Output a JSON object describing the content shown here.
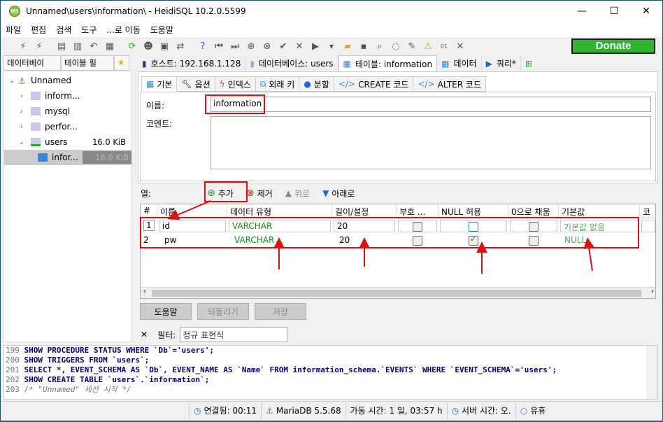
{
  "window": {
    "title": "Unnamed\\users\\information\\ - HeidiSQL 10.2.0.5599",
    "app_icon": "HS"
  },
  "menu": [
    "파일",
    "편집",
    "검색",
    "도구",
    "...로 이동",
    "도움말"
  ],
  "donate_label": "Donate",
  "left_tabs": [
    "데이터베이",
    "테이블 필"
  ],
  "tree": [
    {
      "label": "Unnamed",
      "size": ""
    },
    {
      "label": "inform...",
      "size": ""
    },
    {
      "label": "mysql",
      "size": ""
    },
    {
      "label": "perfor...",
      "size": ""
    },
    {
      "label": "users",
      "size": "16.0 KiB"
    },
    {
      "label": "infor...",
      "size": "16.0 KiB"
    }
  ],
  "main_tabs": [
    "호스트: 192.168.1.128",
    "데이터베이스: users",
    "테이블: information",
    "데이터",
    "쿼리*"
  ],
  "sub_tabs": [
    "기본",
    "옵션",
    "인덱스",
    "외래 키",
    "분할",
    "CREATE 코드",
    "ALTER 코드"
  ],
  "form": {
    "name_label": "이름:",
    "name_value": "information",
    "comment_label": "코멘트:"
  },
  "columns_bar": {
    "label": "열:",
    "add": "추가",
    "remove": "제거",
    "up": "위로",
    "down": "아래로"
  },
  "grid": {
    "headers": [
      "#",
      "이름",
      "데이터 유형",
      "길이/설정",
      "부호 ...",
      "NULL 허용",
      "0으로 채움",
      "기본값",
      "코"
    ],
    "rows": [
      {
        "num": "1",
        "name": "id",
        "type": "VARCHAR",
        "length": "20",
        "unsigned": false,
        "nullable": false,
        "zerofill": false,
        "default": "기본값 없음"
      },
      {
        "num": "2",
        "name": "pw",
        "type": "VARCHAR",
        "length": "20",
        "unsigned": false,
        "nullable": true,
        "zerofill": false,
        "default": "NULL"
      }
    ]
  },
  "buttons": {
    "help": "도움말",
    "discard": "되돌리기",
    "save": "저장"
  },
  "filter": {
    "close": "✕",
    "label": "필터:",
    "placeholder": "정규 표현식"
  },
  "sql_log": [
    {
      "n": "199",
      "text": "SHOW PROCEDURE STATUS WHERE `Db`='users';"
    },
    {
      "n": "200",
      "text": "SHOW TRIGGERS FROM `users`;"
    },
    {
      "n": "201",
      "text": "SELECT *, EVENT_SCHEMA AS `Db`, EVENT_NAME AS `Name` FROM information_schema.`EVENTS` WHERE `EVENT_SCHEMA`='users';"
    },
    {
      "n": "202",
      "text": "SHOW CREATE TABLE `users`.`information`;"
    },
    {
      "n": "203",
      "text": "/* \"Unnamed\" 세션 시작 */"
    }
  ],
  "status": {
    "connected": "연결됨: 00:11",
    "server": "MariaDB 5.5.68",
    "uptime": "가동 시간: 1 일, 03:57 h",
    "server_time": "서버 시간: 오.",
    "idle": "유휴"
  },
  "colors": {
    "accent_red": "#e01010",
    "donate_green": "#2fb42f",
    "type_green": "#1a8a1a"
  }
}
